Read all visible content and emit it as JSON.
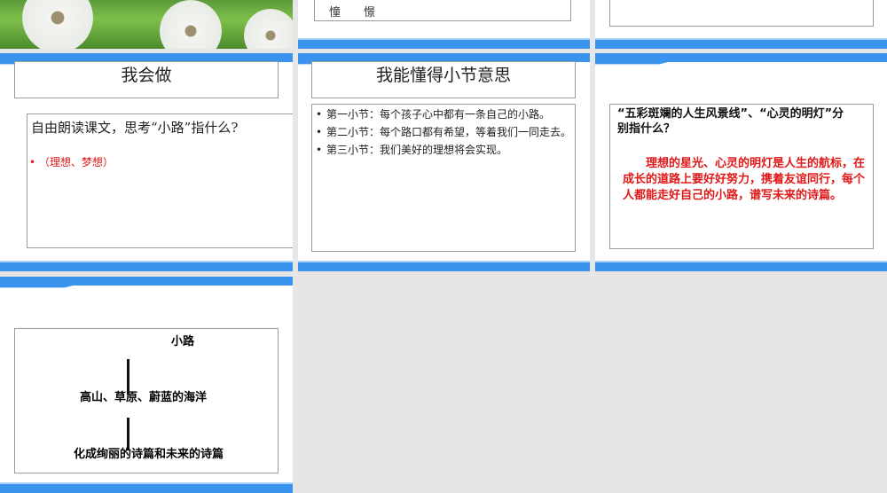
{
  "slides": [
    {
      "id": "photo"
    },
    {
      "id": "vocab",
      "text": "憧　　憬"
    },
    {
      "id": "blank"
    },
    {
      "id": "wo-hui-zuo",
      "title": "我会做",
      "question": "自由朗读课文，思考“小路”指什么?",
      "answer": "（理想、梦想）"
    },
    {
      "id": "section-meaning",
      "title": "我能懂得小节意思",
      "bullets": [
        "第一小节：每个孩子心中都有一条自己的小路。",
        "第二小节：每个路口都有希望，等着我们一同走去。",
        "第三小节：我们美好的理想将会实现。"
      ]
    },
    {
      "id": "question",
      "question": "“五彩斑斓的人生风景线”、“心灵的明灯”分别指什么？",
      "answer": "理想的星光、心灵的明灯是人生的航标，在成长的道路上要好好努力，携着友谊同行，每个人都能走好自己的小路，谱写未来的诗篇。"
    },
    {
      "id": "diagram",
      "top": "小路",
      "middle": "高山、草原、蔚蓝的海洋",
      "bottom": "化成绚丽的诗篇和未来的诗篇"
    }
  ],
  "colors": {
    "accent": "#3a94ee",
    "answer": "#e01818"
  }
}
